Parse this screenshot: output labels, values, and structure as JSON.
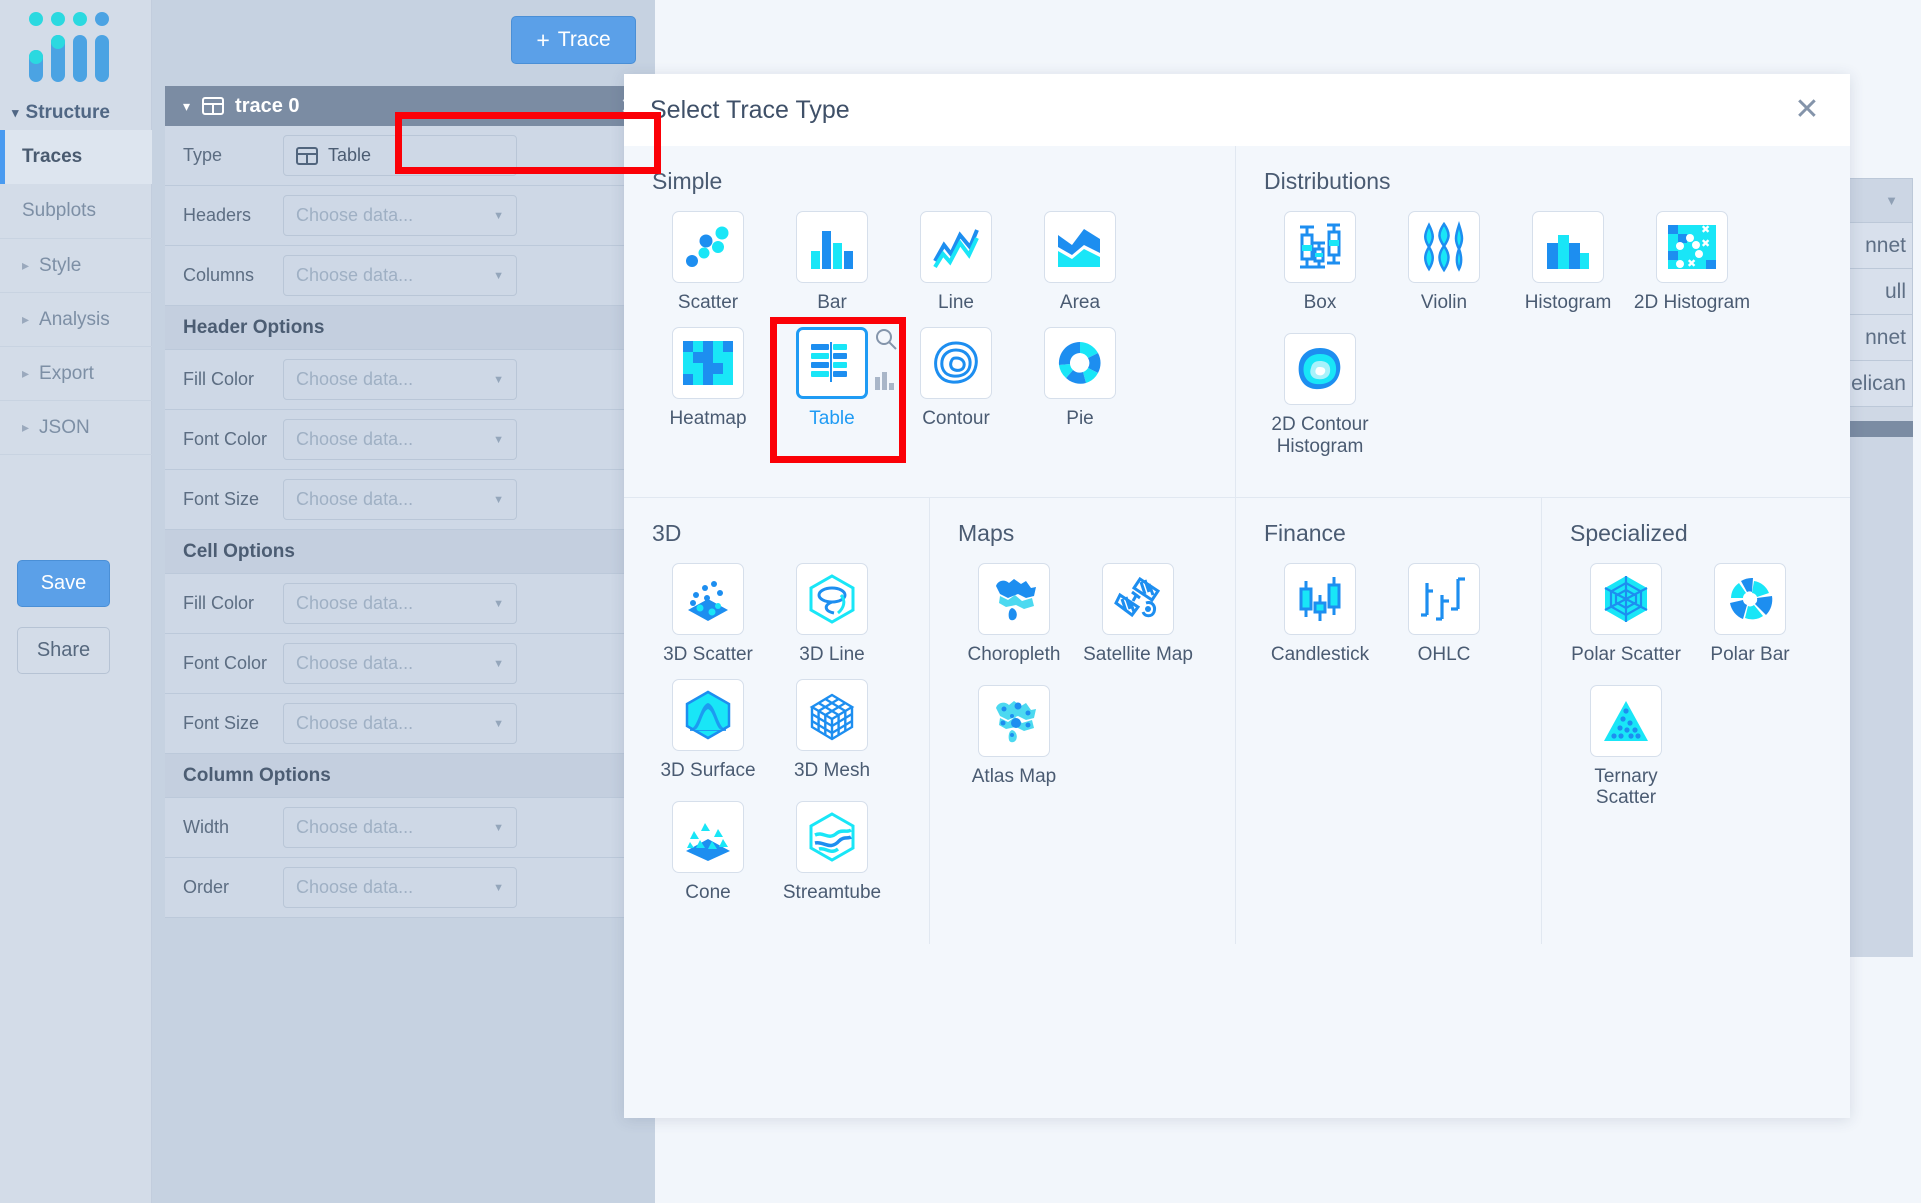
{
  "sidebar": {
    "logo_name": "plotly-logo",
    "structure_label": "Structure",
    "items": [
      {
        "label": "Traces",
        "active": true
      },
      {
        "label": "Subplots",
        "active": false
      },
      {
        "label": "Style",
        "active": false
      },
      {
        "label": "Analysis",
        "active": false
      },
      {
        "label": "Export",
        "active": false
      },
      {
        "label": "JSON",
        "active": false
      }
    ],
    "save_label": "Save",
    "share_label": "Share"
  },
  "editor": {
    "add_trace_label": "Trace",
    "add_trace_plus": "+",
    "panel": {
      "title": "trace 0",
      "close_label": "×",
      "collapse_icon": "chevron-down-icon",
      "rows": [
        {
          "label": "Type",
          "value": "Table",
          "placeholder": "",
          "has_icon": true
        },
        {
          "label": "Headers",
          "value": "",
          "placeholder": "Choose data..."
        },
        {
          "label": "Columns",
          "value": "",
          "placeholder": "Choose data..."
        }
      ],
      "header_options_title": "Header Options",
      "header_options": [
        {
          "label": "Fill Color",
          "placeholder": "Choose data..."
        },
        {
          "label": "Font Color",
          "placeholder": "Choose data..."
        },
        {
          "label": "Font Size",
          "placeholder": "Choose data..."
        }
      ],
      "cell_options_title": "Cell Options",
      "cell_options": [
        {
          "label": "Fill Color",
          "placeholder": "Choose data..."
        },
        {
          "label": "Font Color",
          "placeholder": "Choose data..."
        },
        {
          "label": "Font Size",
          "placeholder": "Choose data..."
        }
      ],
      "column_options_title": "Column Options",
      "column_options": [
        {
          "label": "Width",
          "placeholder": "Choose data..."
        },
        {
          "label": "Order",
          "placeholder": "Choose data..."
        }
      ]
    }
  },
  "background_table": {
    "rows": [
      "nnet",
      "ull",
      "nnet",
      "Pelican"
    ]
  },
  "modal": {
    "title": "Select Trace Type",
    "close_label": "✕",
    "groups": [
      {
        "title": "Simple",
        "tiles": [
          {
            "label": "Scatter",
            "icon": "scatter-icon",
            "selected": false
          },
          {
            "label": "Bar",
            "icon": "bar-icon",
            "selected": false
          },
          {
            "label": "Line",
            "icon": "line-icon",
            "selected": false
          },
          {
            "label": "Area",
            "icon": "area-icon",
            "selected": false
          },
          {
            "label": "Heatmap",
            "icon": "heatmap-icon",
            "selected": false
          },
          {
            "label": "Table",
            "icon": "table-icon",
            "selected": true
          },
          {
            "label": "Contour",
            "icon": "contour-icon",
            "selected": false
          },
          {
            "label": "Pie",
            "icon": "pie-icon",
            "selected": false
          }
        ]
      },
      {
        "title": "Distributions",
        "tiles": [
          {
            "label": "Box",
            "icon": "box-plot-icon",
            "selected": false
          },
          {
            "label": "Violin",
            "icon": "violin-icon",
            "selected": false
          },
          {
            "label": "Histogram",
            "icon": "histogram-icon",
            "selected": false
          },
          {
            "label": "2D Histogram",
            "icon": "histogram-2d-icon",
            "selected": false
          },
          {
            "label": "2D Contour Histogram",
            "icon": "contour-histogram-2d-icon",
            "selected": false
          }
        ]
      },
      {
        "title": "3D",
        "tiles": [
          {
            "label": "3D Scatter",
            "icon": "scatter-3d-icon",
            "selected": false
          },
          {
            "label": "3D Line",
            "icon": "line-3d-icon",
            "selected": false
          },
          {
            "label": "3D Surface",
            "icon": "surface-3d-icon",
            "selected": false
          },
          {
            "label": "3D Mesh",
            "icon": "mesh-3d-icon",
            "selected": false
          },
          {
            "label": "Cone",
            "icon": "cone-icon",
            "selected": false
          },
          {
            "label": "Streamtube",
            "icon": "streamtube-icon",
            "selected": false
          }
        ]
      },
      {
        "title": "Maps",
        "tiles": [
          {
            "label": "Choropleth",
            "icon": "choropleth-icon",
            "selected": false
          },
          {
            "label": "Satellite Map",
            "icon": "satellite-map-icon",
            "selected": false
          },
          {
            "label": "Atlas Map",
            "icon": "atlas-map-icon",
            "selected": false
          }
        ]
      },
      {
        "title": "Finance",
        "tiles": [
          {
            "label": "Candlestick",
            "icon": "candlestick-icon",
            "selected": false
          },
          {
            "label": "OHLC",
            "icon": "ohlc-icon",
            "selected": false
          }
        ]
      },
      {
        "title": "Specialized",
        "tiles": [
          {
            "label": "Polar Scatter",
            "icon": "polar-scatter-icon",
            "selected": false
          },
          {
            "label": "Polar Bar",
            "icon": "polar-bar-icon",
            "selected": false
          },
          {
            "label": "Ternary Scatter",
            "icon": "ternary-scatter-icon",
            "selected": false
          }
        ]
      }
    ]
  },
  "colors": {
    "accent": "#1f9bf4",
    "cyan": "#19e6f7",
    "blue": "#2196f3",
    "highlight": "#fb0007",
    "panel_header": "#7b8ca3"
  }
}
